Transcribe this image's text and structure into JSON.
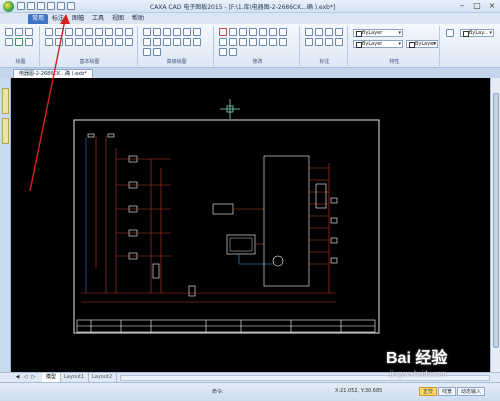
{
  "titlebar": {
    "title": "CAXA CAD 电子图板2015 - [F:\\1.库\\电器图-2-2686CK...确 ).exb*]"
  },
  "menu": {
    "tabs": [
      "常用",
      "标注",
      "图幅",
      "工具",
      "视图",
      "帮助"
    ],
    "active": "常用"
  },
  "ribbon": {
    "groups": [
      "绘图",
      "修改",
      "标注",
      "特性"
    ],
    "hidden_group_label": "基本绘图",
    "hidden_group_label_2": "高级绘图",
    "layer_value": "ByLayer",
    "linetype_value": "ByLayer",
    "color_value": "ByLayer",
    "small_combo": "ByLay..."
  },
  "document": {
    "tab_label": "电器图-2-2686CK...确 ).exb*"
  },
  "layout": {
    "tabs": [
      "模型",
      "Layout1",
      "Layout2"
    ],
    "active": "模型"
  },
  "statusbar": {
    "prompt": "命令:",
    "coords": "X:21.052, Y:30.685",
    "buttons": [
      "正交",
      "线宽",
      "动态输入"
    ],
    "active_button": "正交"
  },
  "watermark": {
    "brand": "Bai 经验",
    "url": "jingyan.baidu.com"
  },
  "colors": {
    "canvas_bg": "#000000",
    "annotation_arrow": "#d42020",
    "wire_red": "#c0392b",
    "frame_white": "#ffffff"
  }
}
